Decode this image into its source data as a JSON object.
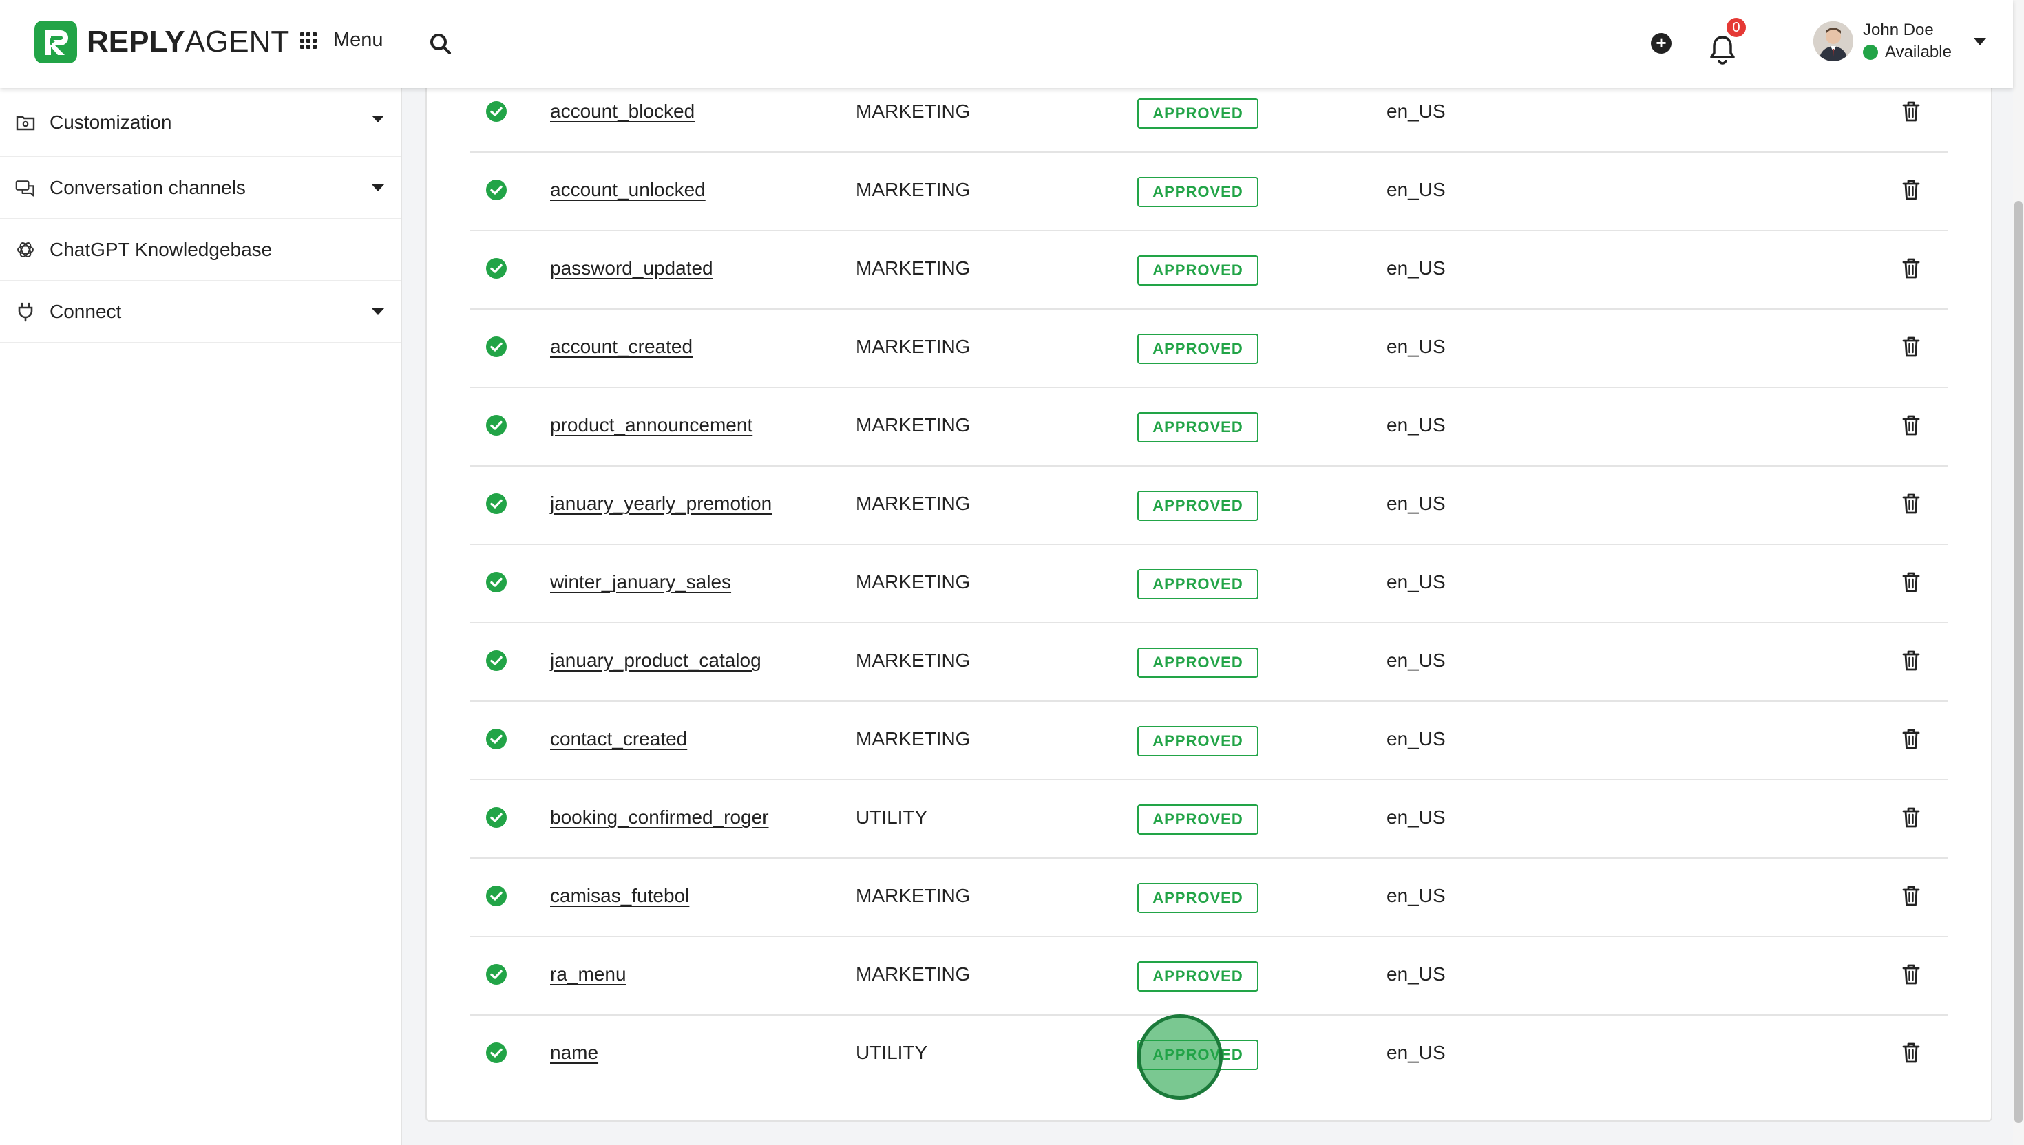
{
  "header": {
    "logo_bold": "REPLY",
    "logo_light": "AGENT",
    "menu_label": "Menu",
    "notifications_count": "0",
    "user": {
      "name": "John Doe",
      "status": "Available"
    }
  },
  "sidebar": {
    "items": [
      {
        "label": "Customization",
        "icon": "folder-gear-icon",
        "has_caret": true
      },
      {
        "label": "Conversation channels",
        "icon": "chat-bubbles-icon",
        "has_caret": true
      },
      {
        "label": "ChatGPT Knowledgebase",
        "icon": "openai-icon",
        "has_caret": false
      },
      {
        "label": "Connect",
        "icon": "plug-icon",
        "has_caret": true
      }
    ]
  },
  "templates": {
    "rows": [
      {
        "name": "account_blocked",
        "category": "MARKETING",
        "status": "APPROVED",
        "language": "en_US"
      },
      {
        "name": "account_unlocked",
        "category": "MARKETING",
        "status": "APPROVED",
        "language": "en_US"
      },
      {
        "name": "password_updated",
        "category": "MARKETING",
        "status": "APPROVED",
        "language": "en_US"
      },
      {
        "name": "account_created",
        "category": "MARKETING",
        "status": "APPROVED",
        "language": "en_US"
      },
      {
        "name": "product_announcement",
        "category": "MARKETING",
        "status": "APPROVED",
        "language": "en_US"
      },
      {
        "name": "january_yearly_premotion",
        "category": "MARKETING",
        "status": "APPROVED",
        "language": "en_US"
      },
      {
        "name": "winter_january_sales",
        "category": "MARKETING",
        "status": "APPROVED",
        "language": "en_US"
      },
      {
        "name": "january_product_catalog",
        "category": "MARKETING",
        "status": "APPROVED",
        "language": "en_US"
      },
      {
        "name": "contact_created",
        "category": "MARKETING",
        "status": "APPROVED",
        "language": "en_US"
      },
      {
        "name": "booking_confirmed_roger",
        "category": "UTILITY",
        "status": "APPROVED",
        "language": "en_US"
      },
      {
        "name": "camisas_futebol",
        "category": "MARKETING",
        "status": "APPROVED",
        "language": "en_US"
      },
      {
        "name": "ra_menu",
        "category": "MARKETING",
        "status": "APPROVED",
        "language": "en_US"
      },
      {
        "name": "name",
        "category": "UTILITY",
        "status": "APPROVED",
        "language": "en_US"
      }
    ]
  },
  "colors": {
    "accent": "#22a447",
    "danger": "#e53935"
  }
}
